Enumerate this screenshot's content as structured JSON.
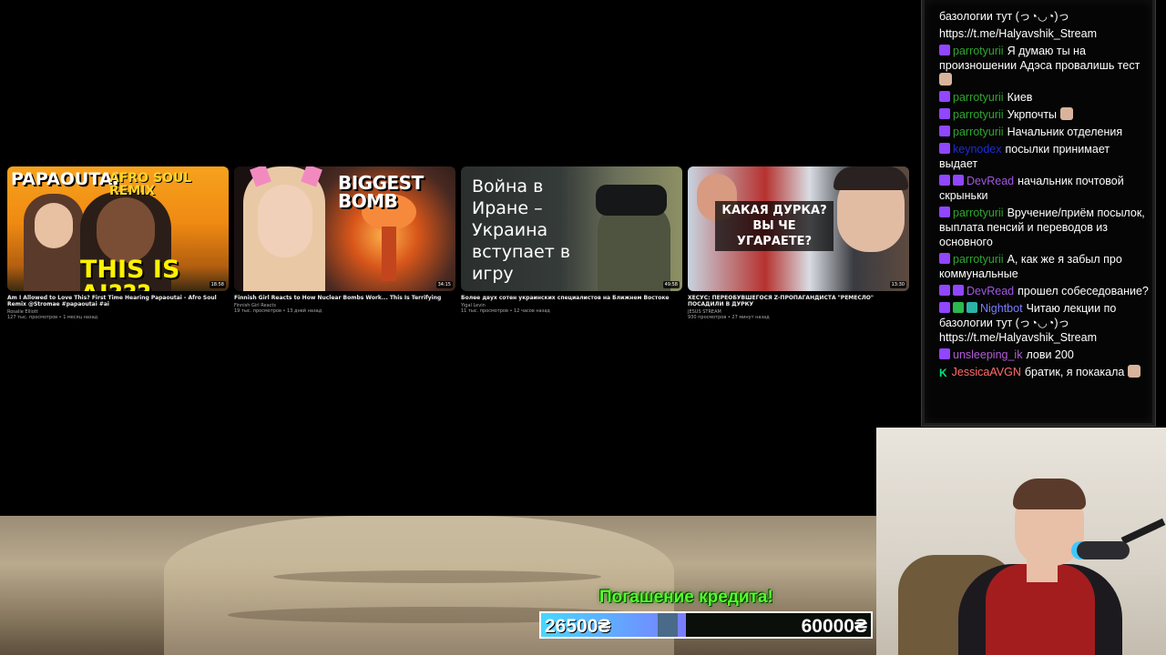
{
  "videos": [
    {
      "thumb_text_top_left": "PAPAOUTAI",
      "thumb_text_top_right": "AFRO SOUL REMIX",
      "thumb_text_bottom": "THIS IS AI???",
      "duration": "18:58",
      "title": "Am I Allowed to Love This? First Time Hearing Papaoutai - Afro Soul Remix @Stromae #papaoutai #ai",
      "channel": "Rosalie Elliott",
      "meta": "127 тыс. просмотров • 1 месяц назад"
    },
    {
      "thumb_text": "BIGGEST BOMB",
      "duration": "34:15",
      "title": "Finnish Girl Reacts to How Nuclear Bombs Work... This Is Terrifying",
      "channel": "Finnish Girl Reacts",
      "meta": "19 тыс. просмотров • 13 дней назад"
    },
    {
      "thumb_text": "Война в Иране – Украина вступает в игру",
      "duration": "49:58",
      "title": "Более двух сотен украинских специалистов на Ближнем Востоке",
      "channel": "Yigal Levin",
      "meta": "11 тыс. просмотров • 12 часов назад"
    },
    {
      "thumb_text": "КАКАЯ ДУРКА? ВЫ ЧЕ УГАРАЕТЕ?",
      "duration": "13:30",
      "title": "ХЕСУС: ПЕРЕОБУВШЕГОСЯ Z-ПРОПАГАНДИСТА \"РЕМЕСЛО\" ПОСАДИЛИ В ДУРКУ",
      "channel": "JESUS STREAM",
      "meta": "930 просмотров • 27 минут назад"
    }
  ],
  "chat": {
    "messages": [
      {
        "badges": [],
        "user": "",
        "user_color": "#ffffff",
        "text": "базологии тут (っ◔◡◔)っ"
      },
      {
        "badges": [],
        "user": "",
        "user_color": "#ffffff",
        "text": "https://t.me/Halyavshik_Stream"
      },
      {
        "badges": [
          "twitch"
        ],
        "user": "parrotyurii",
        "user_color": "#2ea52e",
        "text": "Я думаю ты на произношении Адэса провалишь тест",
        "emote": true
      },
      {
        "badges": [
          "twitch"
        ],
        "user": "parrotyurii",
        "user_color": "#2ea52e",
        "text": "Киев"
      },
      {
        "badges": [
          "twitch"
        ],
        "user": "parrotyurii",
        "user_color": "#2ea52e",
        "text": "Укрпочты",
        "emote": true
      },
      {
        "badges": [
          "twitch"
        ],
        "user": "parrotyurii",
        "user_color": "#2ea52e",
        "text": "Начальник отделения"
      },
      {
        "badges": [
          "twitch"
        ],
        "user": "keynodex",
        "user_color": "#1e2bd6",
        "text": "посылки принимает выдает"
      },
      {
        "badges": [
          "twitch",
          "twitch"
        ],
        "user": "DevRead",
        "user_color": "#a157e0",
        "text": "начальник почтовой скрыньки"
      },
      {
        "badges": [
          "twitch"
        ],
        "user": "parrotyurii",
        "user_color": "#2ea52e",
        "text": "Вручение/приём посылок, выплата пенсий и переводов из основного"
      },
      {
        "badges": [
          "twitch"
        ],
        "user": "parrotyurii",
        "user_color": "#2ea52e",
        "text": "А, как же я забыл про коммунальные"
      },
      {
        "badges": [
          "twitch",
          "twitch"
        ],
        "user": "DevRead",
        "user_color": "#a157e0",
        "text": "прошел собеседование?"
      },
      {
        "badges": [
          "twitch",
          "green",
          "teal"
        ],
        "user": "Nightbot",
        "user_color": "#7c7cff",
        "text": "Читаю лекции по базологии тут (っ◔◡◔)っ https://t.me/Halyavshik_Stream"
      },
      {
        "badges": [
          "twitch"
        ],
        "user": "unsleeping_ik",
        "user_color": "#b05bd6",
        "text": "лови 200"
      },
      {
        "badges": [
          "k"
        ],
        "user": "JessicaAVGN",
        "user_color": "#ff6b6b",
        "text": "братик, я покакала",
        "emote": true
      }
    ]
  },
  "goal": {
    "title": "Погашение кредита!",
    "current": "26500₴",
    "target": "60000₴",
    "progress_fraction": 0.44,
    "fill_color": "#48d7ff",
    "title_color": "#53ff2e"
  }
}
